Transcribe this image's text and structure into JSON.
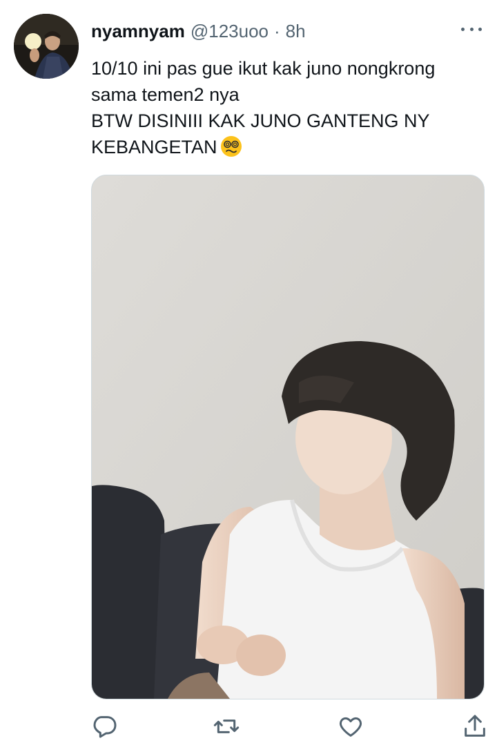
{
  "tweet": {
    "author_name": "nyamnyam",
    "author_handle": "@123uoo",
    "separator": "·",
    "time_ago": "8h",
    "text_lines": [
      "10/10 ini pas gue ikut kak juno nongkrong",
      "sama temen2 nya",
      "BTW DISINIII KAK JUNO GANTENG NY",
      "KEBANGETAN"
    ],
    "emoji": "dizzy-face-emoji"
  },
  "actions": [
    "reply-icon",
    "retweet-icon",
    "like-icon",
    "share-icon"
  ],
  "colors": {
    "text": "#0f1419",
    "secondary": "#536471",
    "border": "#cfd9de",
    "background": "#ffffff"
  }
}
